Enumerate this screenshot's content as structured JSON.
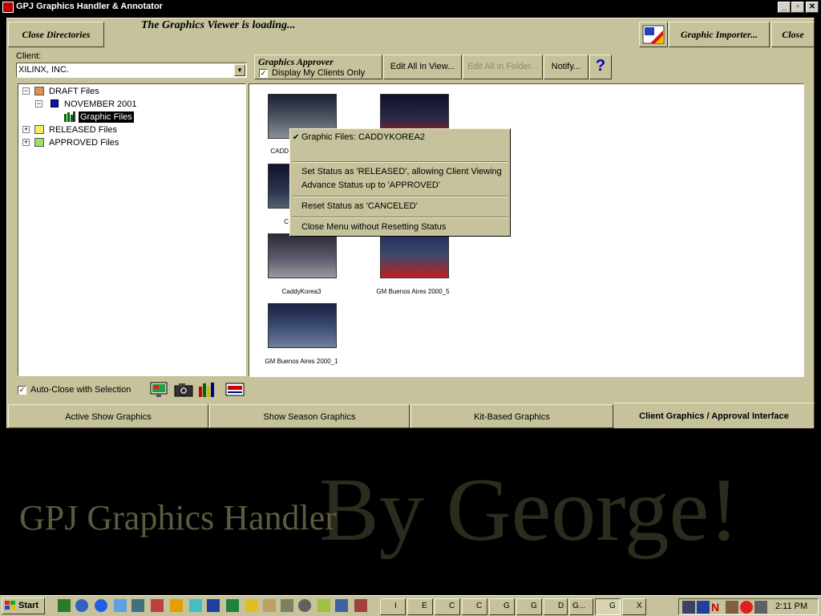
{
  "window": {
    "title": "GPJ Graphics Handler & Annotator",
    "controls": {
      "minimize": "_",
      "restore": "▫",
      "close": "✕"
    }
  },
  "toolbar": {
    "close_directories": "Close Directories",
    "status_message": "The Graphics Viewer is loading...",
    "graphic_importer": "Graphic Importer...",
    "close": "Close"
  },
  "client": {
    "label": "Client:",
    "selected": "XILINX, INC."
  },
  "approver": {
    "title": "Graphics Approver",
    "display_my_clients_label": "Display My Clients Only",
    "display_my_clients_checked": true,
    "edit_all_in_view": "Edit All in View...",
    "edit_all_in_folder": "Edit All in Folder...",
    "notify": "Notify...",
    "help": "?"
  },
  "tree": {
    "draft": "DRAFT Files",
    "november": "NOVEMBER 2001",
    "graphic_files": "Graphic Files",
    "released": "RELEASED Files",
    "approved": "APPROVED Files"
  },
  "thumbnails": [
    {
      "caption": "CADD",
      "color": "#4a5462"
    },
    {
      "caption": "",
      "color": "#2a2a4a"
    },
    {
      "caption": "C",
      "color": "#2b3350"
    },
    {
      "caption": "CaddyKorea3",
      "color": "#5a5a6a"
    },
    {
      "caption": "GM Buenos Aires 2000_5",
      "color": "#803030"
    },
    {
      "caption": "GM Buenos Aires 2000_1",
      "color": "#3a4a70"
    }
  ],
  "context_menu": {
    "header": "Graphic Files: CADDYKOREA2",
    "set_released": "Set Status as 'RELEASED', allowing Client Viewing",
    "advance_approved": "Advance Status up to 'APPROVED'",
    "reset_canceled": "Reset Status as 'CANCELED'",
    "close_menu": "Close Menu without Resetting Status"
  },
  "footer": {
    "auto_close_label": "Auto-Close with Selection",
    "auto_close_checked": true
  },
  "tabs": [
    "Active Show Graphics",
    "Show Season Graphics",
    "Kit-Based Graphics",
    "Client Graphics / Approval Interface"
  ],
  "splash": {
    "app_name": "GPJ Graphics Handler",
    "by_line": "By George!"
  },
  "taskbar": {
    "start": "Start",
    "tasks": [
      "I",
      "E",
      "C",
      "C",
      "G",
      "G",
      "D",
      "G...",
      "G",
      "X"
    ],
    "clock": "2:11 PM"
  },
  "colors": {
    "face": "#c6c29c",
    "background": "#000000",
    "help_blue": "#0000c0",
    "selection": "#000000"
  }
}
